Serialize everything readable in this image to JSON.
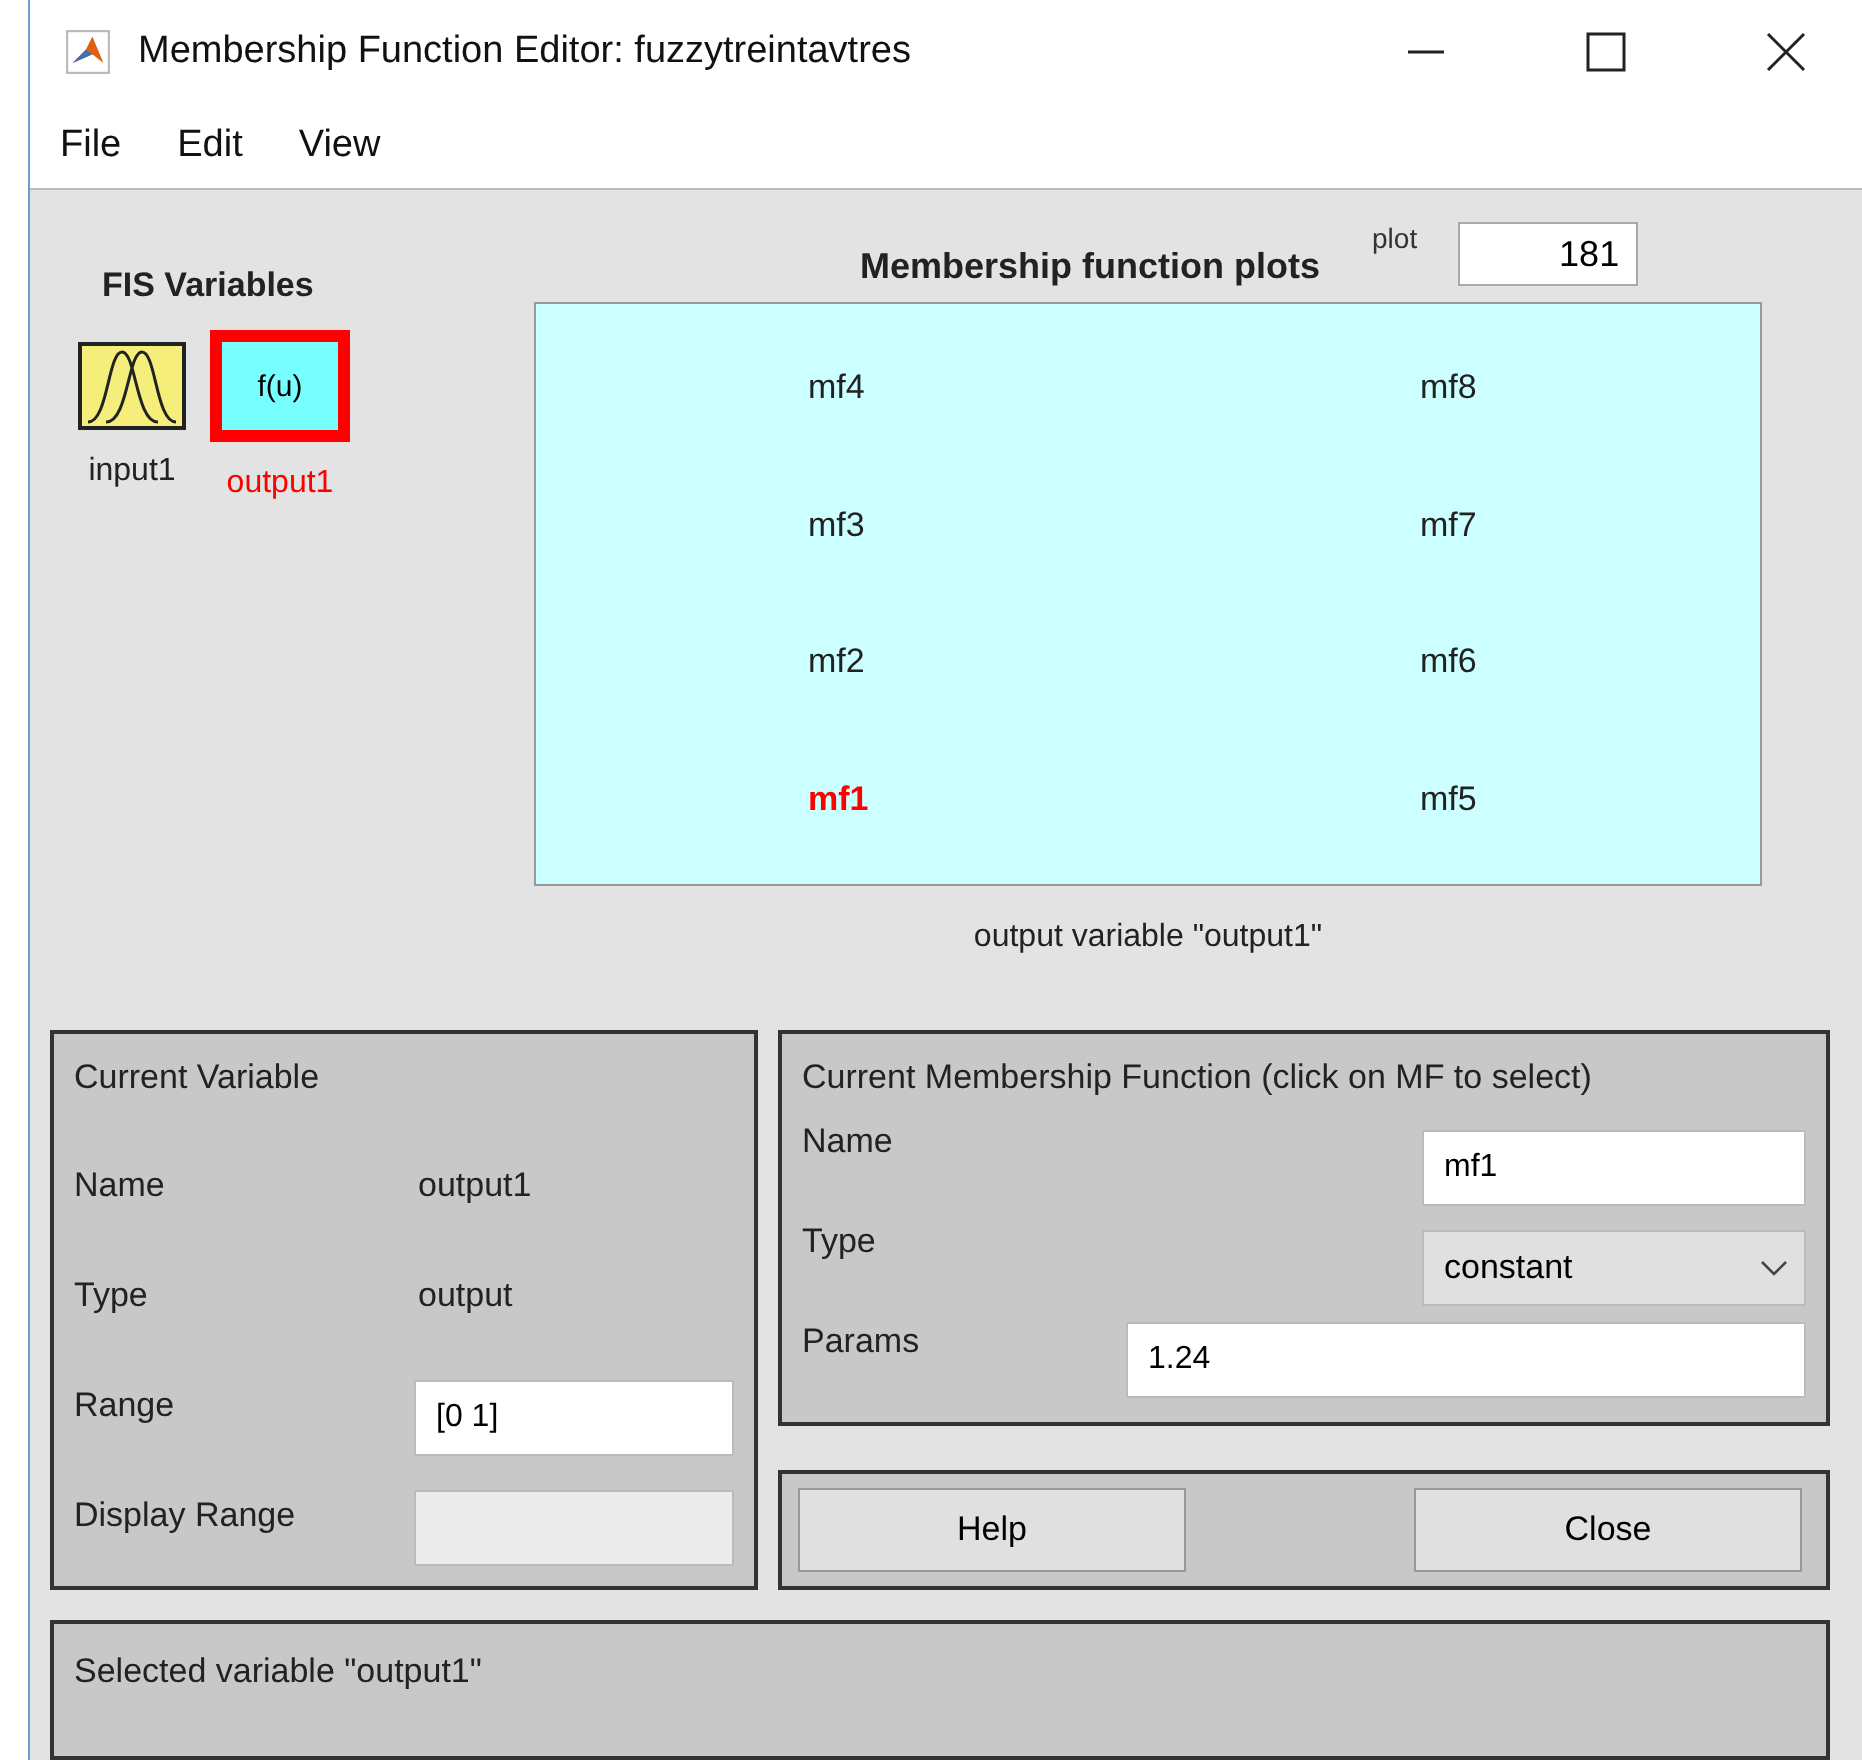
{
  "window": {
    "title": "Membership Function Editor: fuzzytreintavtres"
  },
  "menu": [
    "File",
    "Edit",
    "View"
  ],
  "fis_variables": {
    "title": "FIS Variables",
    "items": [
      {
        "kind": "input",
        "label": "input1",
        "selected": false
      },
      {
        "kind": "output",
        "label": "output1",
        "icon_text": "f(u)",
        "selected": true
      }
    ]
  },
  "plot": {
    "title": "Membership function plots",
    "points_label": "plot",
    "points_value": "181",
    "caption": "output variable \"output1\"",
    "mfs": [
      {
        "label": "mf4",
        "selected": false
      },
      {
        "label": "mf3",
        "selected": false
      },
      {
        "label": "mf2",
        "selected": false
      },
      {
        "label": "mf1",
        "selected": true
      },
      {
        "label": "mf8",
        "selected": false
      },
      {
        "label": "mf7",
        "selected": false
      },
      {
        "label": "mf6",
        "selected": false
      },
      {
        "label": "mf5",
        "selected": false
      }
    ]
  },
  "current_variable": {
    "title": "Current Variable",
    "name_label": "Name",
    "name": "output1",
    "type_label": "Type",
    "type": "output",
    "range_label": "Range",
    "range": "[0 1]",
    "display_range_label": "Display Range",
    "display_range_disabled": true
  },
  "current_mf": {
    "title": "Current Membership Function (click on MF to select)",
    "name_label": "Name",
    "name": "mf1",
    "type_label": "Type",
    "type": "constant",
    "params_label": "Params",
    "params": "1.24"
  },
  "buttons": [
    "Help",
    "Close"
  ],
  "status": "Selected variable \"output1\""
}
